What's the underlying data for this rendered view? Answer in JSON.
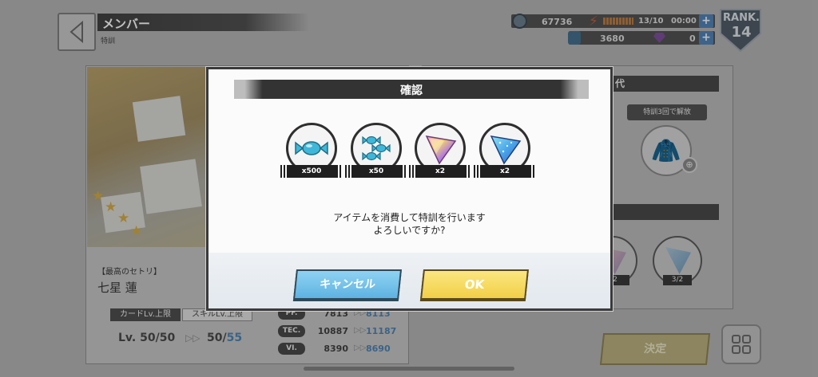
{
  "header": {
    "title": "メンバー",
    "subtitle": "特訓"
  },
  "status": {
    "coins": "67736",
    "stamina": "13/10",
    "timer": "00:00",
    "gems": "3680",
    "jewels": "0",
    "rank_label": "RANK.",
    "rank": "14",
    "plus": "+"
  },
  "card": {
    "best_label": "【最高のセトリ】",
    "name": "七星 蓮",
    "tab_card": "カードLv.上限",
    "tab_skill": "スキルLv.上限",
    "lv_prefix": "Lv.",
    "lv_current": "50/",
    "lv_current_max": "50",
    "lv_new_current": "50/",
    "lv_new_max": "55",
    "stats": [
      {
        "tag": "PF.",
        "old": "7813",
        "new": "8113"
      },
      {
        "tag": "TEC.",
        "old": "10887",
        "new": "11187"
      },
      {
        "tag": "VI.",
        "old": "8390",
        "new": "8690"
      }
    ]
  },
  "right_panel": {
    "head": "代",
    "unlock_tip": "特訓3回で解放",
    "small_counts": [
      "2",
      "3/2"
    ],
    "decide": "決定"
  },
  "dialog": {
    "title": "確認",
    "items": [
      {
        "icon": "candy-icon",
        "count": "x500"
      },
      {
        "icon": "candy-pile-icon",
        "count": "x50"
      },
      {
        "icon": "rainbow-shard-icon",
        "count": "x2"
      },
      {
        "icon": "blue-shard-icon",
        "count": "x2"
      }
    ],
    "message_line1": "アイテムを消費して特訓を行います",
    "message_line2": "よろしいですか?",
    "cancel": "キャンセル",
    "ok": "OK"
  },
  "colors": {
    "cancel_button": "#5eb3e2",
    "ok_button": "#f2cf47",
    "title_bar": "#333333"
  }
}
